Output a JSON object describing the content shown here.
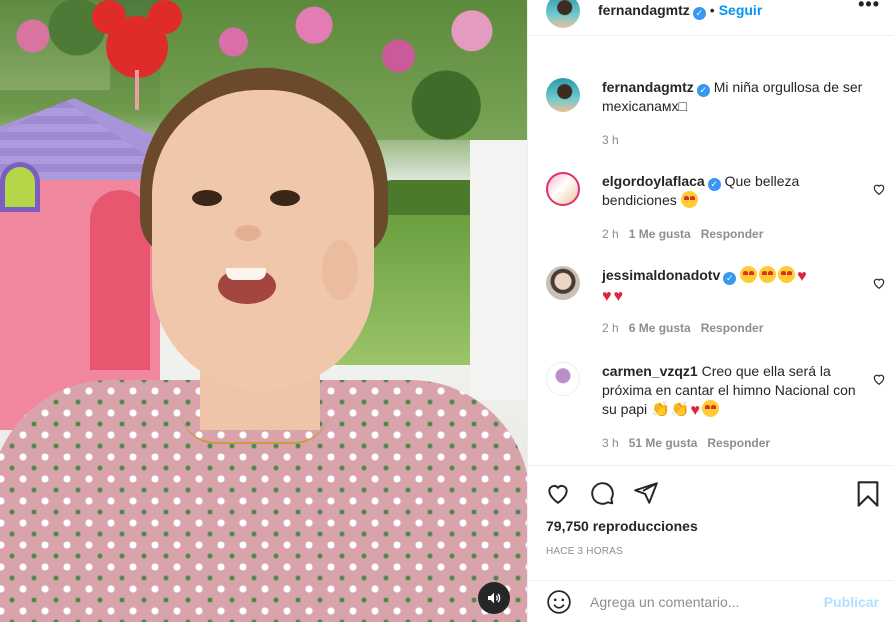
{
  "post": {
    "username": "fernandagmtz",
    "follow_label": "Seguir",
    "dot": "•",
    "more": "•••",
    "verified_mark": "✓"
  },
  "caption": {
    "username": "fernandagmtz",
    "text": "Mi niña orgullosa de ser mexicanaмх□",
    "time": "3 h"
  },
  "comments": [
    {
      "username": "elgordoylaflaca",
      "text": "Que belleza bendiciones",
      "time": "2 h",
      "likes": "1 Me gusta",
      "reply": "Responder",
      "emoji": [
        "heart-eyes"
      ]
    },
    {
      "username": "jessimaldonadotv",
      "text": "",
      "time": "2 h",
      "likes": "6 Me gusta",
      "reply": "Responder",
      "emoji": [
        "heart-eyes",
        "heart-eyes",
        "heart-eyes",
        "red-heart",
        "red-heart",
        "red-heart"
      ]
    },
    {
      "username": "carmen_vzqz1",
      "text": "Creo que ella será la próxima en cantar el himno Nacional con su papi",
      "time": "3 h",
      "likes": "51 Me gusta",
      "reply": "Responder",
      "emoji": [
        "clap",
        "clap",
        "red-heart",
        "heart-eyes"
      ]
    }
  ],
  "stats": {
    "views": "79,750 reproducciones",
    "posted": "HACE 3 HORAS"
  },
  "composer": {
    "placeholder": "Agrega un comentario...",
    "post_label": "Publicar"
  },
  "icons": [
    "heart-icon",
    "comment-icon",
    "share-icon",
    "bookmark-icon",
    "emoji-icon",
    "speaker-icon",
    "more-options-icon"
  ],
  "colors": {
    "accent": "#0095f6",
    "verified": "#3897f0",
    "muted_text": "#8e8e8e"
  }
}
